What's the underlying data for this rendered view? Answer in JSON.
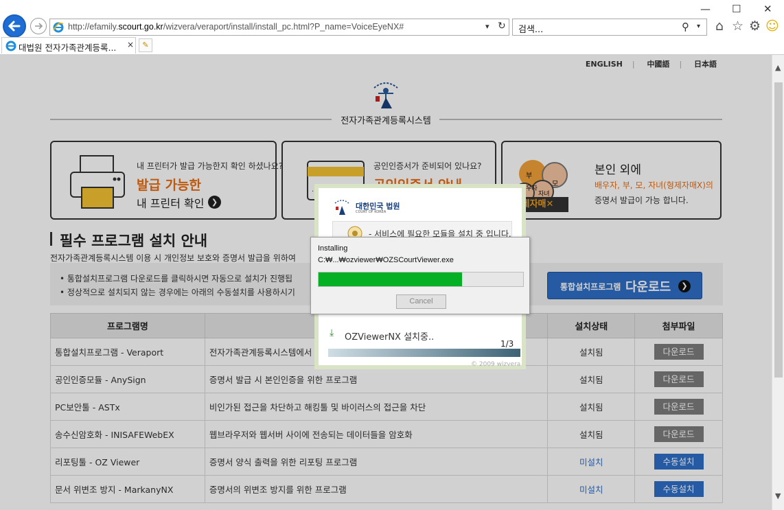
{
  "browser": {
    "url_prefix": "http://efamily.",
    "url_domain": "scourt.go.kr",
    "url_path": "/wizvera/veraport/install/install_pc.html?P_name=VoiceEyeNX#",
    "search_placeholder": "검색...",
    "tab_title": "대법원 전자가족관계등록...",
    "tab_close": "×"
  },
  "header": {
    "languages": [
      "ENGLISH",
      "中國語",
      "日本語"
    ],
    "system_title": "전자가족관계등록시스템"
  },
  "cards": {
    "printer": {
      "question": "내 프린터가 발급 가능한지 확인 하셨나요?",
      "big": "발급 가능한",
      "sub": "내 프린터 확인"
    },
    "cert": {
      "question": "공인인증서가 준비되어 있나요?",
      "big": "공인인증서 안내"
    },
    "family": {
      "title": "본인 외에",
      "line1": "배우자, 부, 모, 자녀(형제자매X)의",
      "line2": "증명서 발급이 가능 합니다.",
      "badge": "제자매✕",
      "labels": [
        "부",
        "모",
        "배우자",
        "자녀"
      ]
    }
  },
  "section": {
    "title": "필수 프로그램 설치 안내",
    "desc": "전자가족관계등록시스템 이용 시 개인정보 보호와 증명서 발급을 위하여",
    "notice1": "• 통합설치프로그램 다운로드를 클릭하시면 자동으로 설치가 진행됩",
    "notice2": "• 정상적으로 설치되지 않는 경우에는 아래의 수동설치를 사용하시기",
    "download_small": "통합설치프로그램",
    "download_big": "다운로드"
  },
  "table": {
    "headers": [
      "프로그램명",
      "",
      "설치상태",
      "첨부파일"
    ],
    "rows": [
      {
        "name": "통합설치프로그램 - Veraport",
        "desc": "전자가족관계등록시스템에서",
        "status": "설치됨",
        "action": "다운로드"
      },
      {
        "name": "공인인증모듈 - AnySign",
        "desc": "증명서 발급 시 본인인증을 위한 프로그램",
        "status": "설치됨",
        "action": "다운로드"
      },
      {
        "name": "PC보안툴 - ASTx",
        "desc": "비인가된 접근을 차단하고 해킹툴 및 바이러스의 접근을 차단",
        "status": "설치됨",
        "action": "다운로드"
      },
      {
        "name": "송수신암호화 - INISAFEWebEX",
        "desc": "웹브라우저와 웹서버 사이에 전송되는 데이터들을 암호화",
        "status": "설치됨",
        "action": "다운로드"
      },
      {
        "name": "리포팅툴 - OZ Viewer",
        "desc": "증명서 양식 출력을 위한 리포팅 프로그램",
        "status": "미설치",
        "action": "수동설치"
      },
      {
        "name": "문서 위변조 방지 - MarkanyNX",
        "desc": "증명서의 위변조 방지를 위한 프로그램",
        "status": "미설치",
        "action": "수동설치"
      }
    ]
  },
  "wizvera": {
    "logo_kr": "대한민국 법원",
    "logo_en": "COURT OF KOREA",
    "message": "- 서비스에 필요한 모듈을 설치 중 입니다.",
    "installing": "OZViewerNX 설치중..",
    "count": "1/3",
    "copyright": "© 2009 wizvera"
  },
  "progress_dialog": {
    "title": "Installing",
    "path": "C:₩...₩ozviewer₩OZSCourtViewer.exe",
    "percent": 70,
    "cancel": "Cancel"
  },
  "colors": {
    "accent_orange": "#e86d10",
    "button_blue": "#2f6fc9",
    "progress_green": "#06b025"
  }
}
